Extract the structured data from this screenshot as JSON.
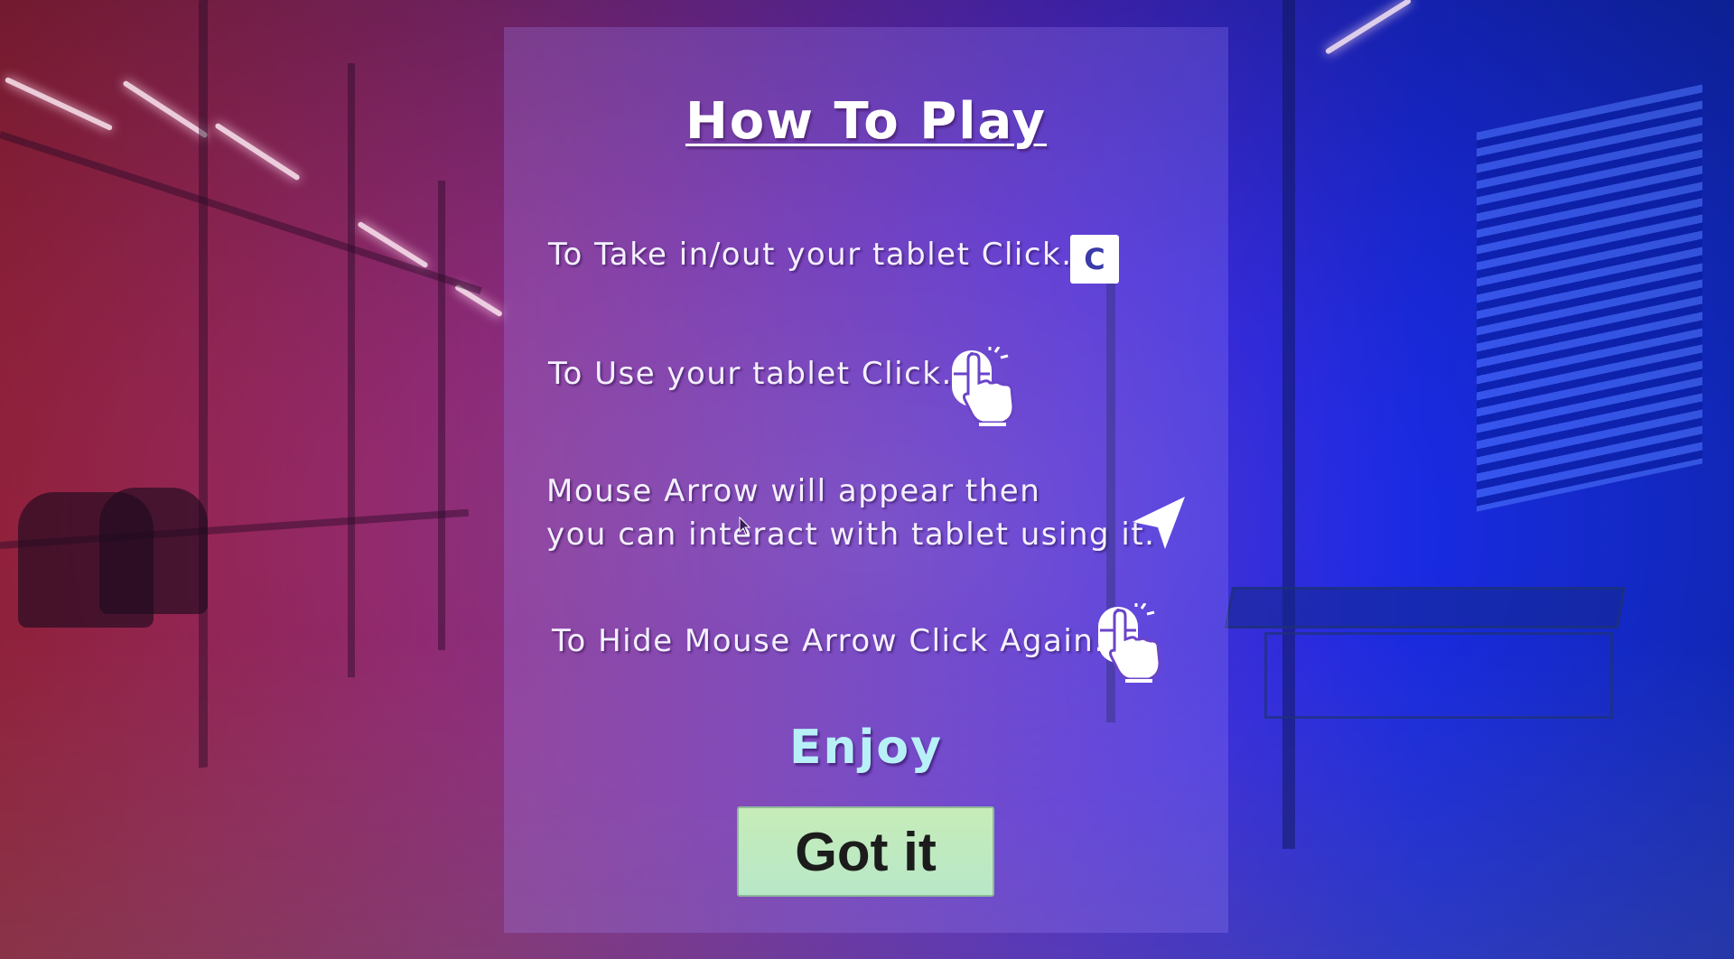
{
  "dialog": {
    "title": "How To Play",
    "instructions": [
      {
        "text": "To Take in/out your tablet Click.",
        "key": "C"
      },
      {
        "text": "To Use your tablet Click.",
        "icon": "mouse-left-click-icon"
      },
      {
        "line1": "Mouse Arrow will appear then",
        "line2": "you can interact with tablet using it.",
        "icon": "mouse-arrow-icon"
      },
      {
        "text": "To Hide Mouse Arrow Click Again.",
        "icon": "mouse-left-click-icon"
      }
    ],
    "closing": "Enjoy",
    "button_label": "Got it"
  },
  "colors": {
    "title": "#ffffff",
    "enjoy": "#b8f0f8",
    "button_bg": "#c6ecb8",
    "button_text": "#1c1c1c",
    "keycap_bg": "#ffffff",
    "keycap_text": "#3a3aa8"
  }
}
